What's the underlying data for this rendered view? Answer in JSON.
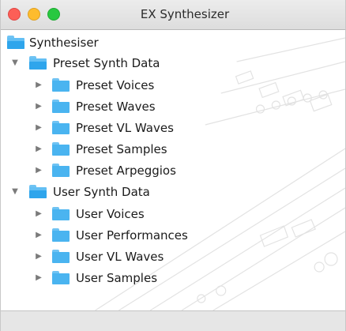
{
  "window": {
    "title": "EX Synthesizer"
  },
  "tree": {
    "root": {
      "label": "Synthesiser",
      "icon": "folder-open-icon"
    },
    "groups": [
      {
        "label": "Preset Synth Data",
        "expanded": true,
        "icon": "folder-open-icon",
        "children": [
          {
            "label": "Preset Voices",
            "icon": "folder-icon"
          },
          {
            "label": "Preset Waves",
            "icon": "folder-icon"
          },
          {
            "label": "Preset VL Waves",
            "icon": "folder-icon"
          },
          {
            "label": "Preset Samples",
            "icon": "folder-icon"
          },
          {
            "label": "Preset Arpeggios",
            "icon": "folder-icon"
          }
        ]
      },
      {
        "label": "User Synth Data",
        "expanded": true,
        "icon": "folder-open-icon",
        "children": [
          {
            "label": "User Voices",
            "icon": "folder-icon"
          },
          {
            "label": "User Performances",
            "icon": "folder-icon"
          },
          {
            "label": "User VL Waves",
            "icon": "folder-icon"
          },
          {
            "label": "User Samples",
            "icon": "folder-icon"
          }
        ]
      }
    ]
  },
  "colors": {
    "close": "#fc5f57",
    "minimize": "#fdbc2e",
    "maximize": "#28c840",
    "folder": "#4ab4f0"
  }
}
